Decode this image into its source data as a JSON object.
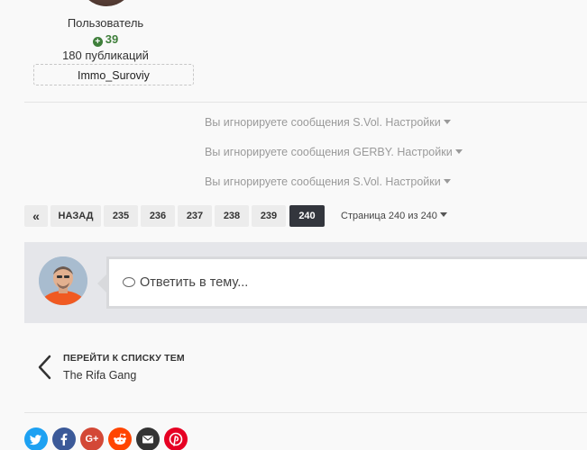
{
  "author": {
    "role": "Пользователь",
    "reputation": "39",
    "posts": "180 публикаций",
    "name": "Immo_Suroviy"
  },
  "ignored_notices": [
    {
      "text": "Вы игнорируете сообщения S.Vol.",
      "settings": "Настройки"
    },
    {
      "text": "Вы игнорируете сообщения GERBY.",
      "settings": "Настройки"
    },
    {
      "text": "Вы игнорируете сообщения S.Vol.",
      "settings": "Настройки"
    }
  ],
  "pagination": {
    "first": "«",
    "prev": "НАЗАД",
    "pages": [
      "235",
      "236",
      "237",
      "238",
      "239",
      "240"
    ],
    "current": "240",
    "info": "Страница 240 из 240"
  },
  "reply": {
    "placeholder": "Ответить в тему..."
  },
  "goto_list": {
    "label": "ПЕРЕЙТИ К СПИСКУ ТЕМ",
    "forum": "The Rifa Gang"
  },
  "share": {
    "buttons": [
      {
        "name": "twitter",
        "color": "#1da1f2"
      },
      {
        "name": "facebook",
        "color": "#3b5998"
      },
      {
        "name": "google-plus",
        "color": "#d34836"
      },
      {
        "name": "reddit",
        "color": "#ff4500"
      },
      {
        "name": "email",
        "color": "#333333"
      },
      {
        "name": "pinterest",
        "color": "#e60023"
      }
    ]
  }
}
